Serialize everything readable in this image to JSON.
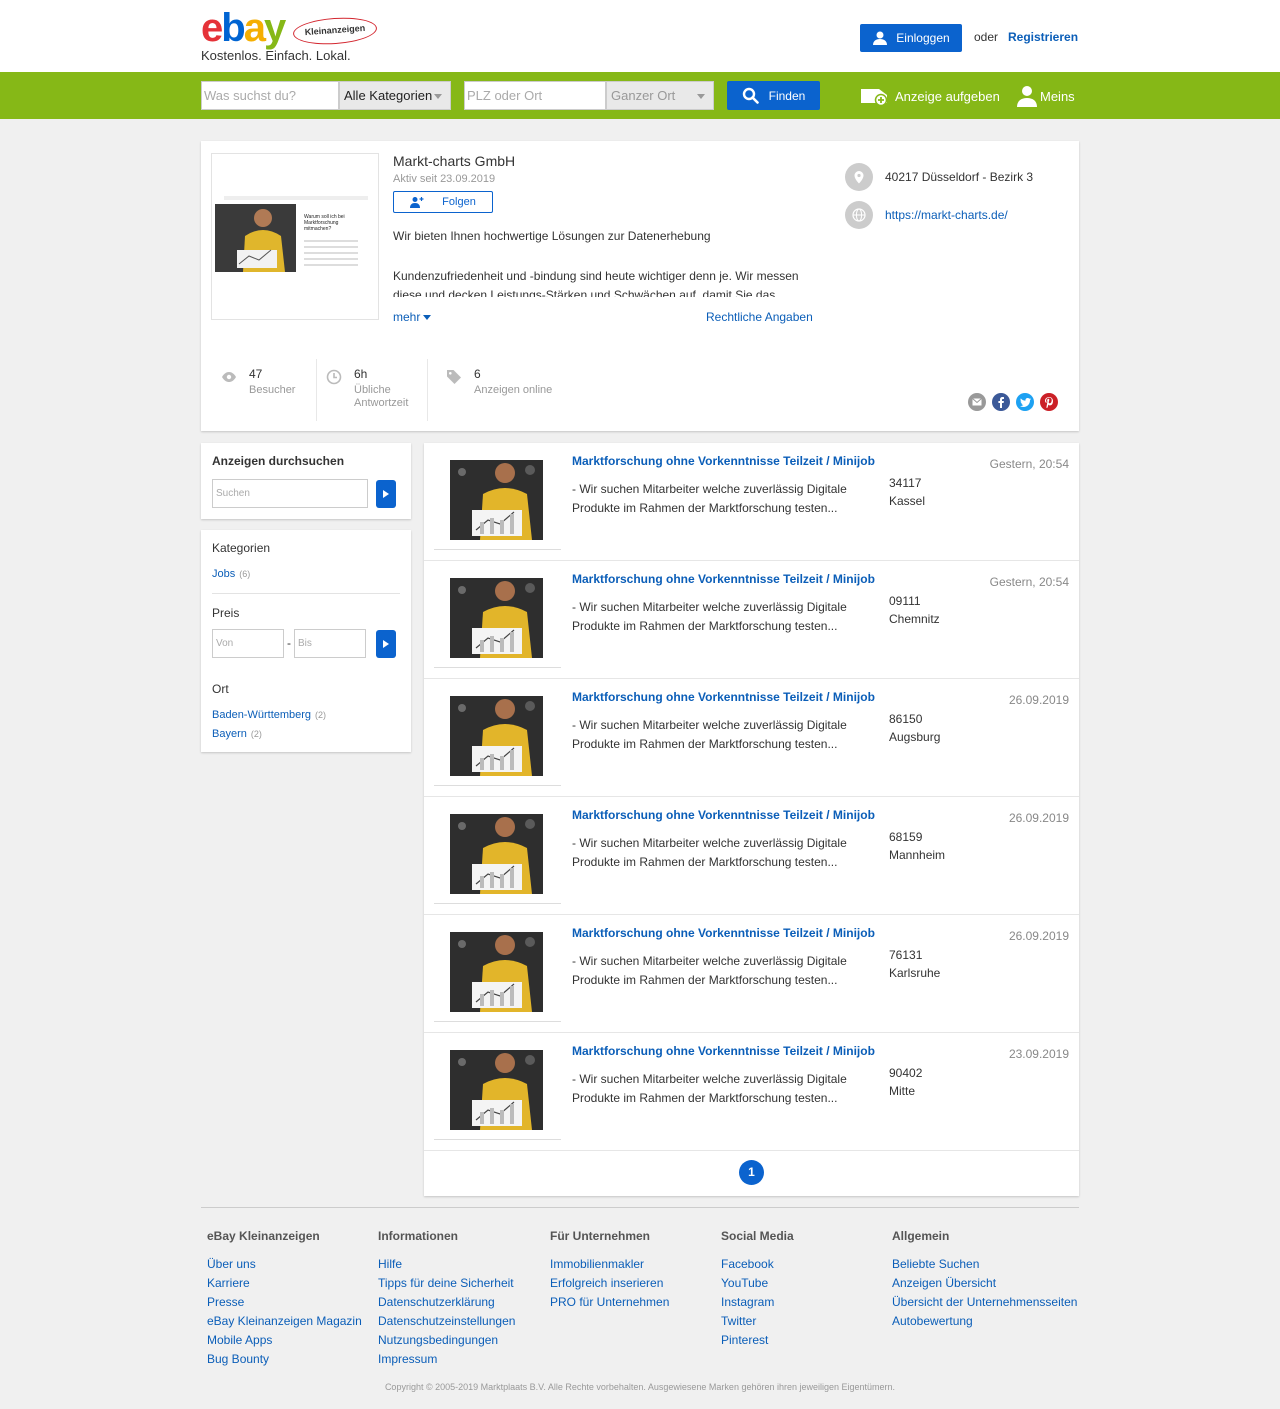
{
  "header": {
    "logo_badge": "Kleinanzeigen",
    "slogan": "Kostenlos. Einfach. Lokal.",
    "login_label": "Einloggen",
    "or_label": "oder",
    "register_label": "Registrieren"
  },
  "searchbar": {
    "query_placeholder": "Was suchst du?",
    "category_selected": "Alle Kategorien",
    "location_placeholder": "PLZ oder Ort",
    "radius_selected": "Ganzer Ort",
    "find_label": "Finden",
    "post_ad_label": "Anzeige aufgeben",
    "my_label": "Meins"
  },
  "profile": {
    "name": "Markt-charts GmbH",
    "active_since": "Aktiv seit 23.09.2019",
    "follow_label": "Folgen",
    "description_line1": "Wir bieten Ihnen hochwertige Lösungen zur Datenerhebung",
    "description_line2": "Kundenzufriedenheit und -bindung sind heute wichtiger denn je. Wir messen diese und decken Leistungs-Stärken und Schwächen auf, damit Sie das",
    "more_label": "mehr",
    "legal_label": "Rechtliche Angaben",
    "address": "40217 Düsseldorf - Bezirk 3",
    "website": "https://markt-charts.de/",
    "preview_text": "Warum soll ich bei Marktforschung mitmachen?",
    "stats": {
      "visitors_value": "47",
      "visitors_label": "Besucher",
      "response_value": "6h",
      "response_label_line1": "Übliche",
      "response_label_line2": "Antwortzeit",
      "ads_value": "6",
      "ads_label": "Anzeigen online"
    }
  },
  "sidebar": {
    "search_title": "Anzeigen durchsuchen",
    "search_placeholder": "Suchen",
    "categories_title": "Kategorien",
    "categories": [
      {
        "label": "Jobs",
        "count": "(6)"
      }
    ],
    "price_title": "Preis",
    "price_from_placeholder": "Von",
    "price_dash": "-",
    "price_to_placeholder": "Bis",
    "location_title": "Ort",
    "locations": [
      {
        "label": "Baden-Württemberg",
        "count": "(2)"
      },
      {
        "label": "Bayern",
        "count": "(2)"
      }
    ]
  },
  "listings": [
    {
      "title": "Marktforschung ohne Vorkenntnisse Teilzeit / Minijob",
      "desc": "- Wir suchen Mitarbeiter welche zuverlässig Digitale Produkte im Rahmen der Marktforschung testen...",
      "zip": "34117",
      "city": "Kassel",
      "date": "Gestern, 20:54"
    },
    {
      "title": "Marktforschung ohne Vorkenntnisse Teilzeit / Minijob",
      "desc": "- Wir suchen Mitarbeiter welche zuverlässig Digitale Produkte im Rahmen der Marktforschung testen...",
      "zip": "09111",
      "city": "Chemnitz",
      "date": "Gestern, 20:54"
    },
    {
      "title": "Marktforschung ohne Vorkenntnisse Teilzeit / Minijob",
      "desc": "- Wir suchen Mitarbeiter welche zuverlässig Digitale Produkte im Rahmen der Marktforschung testen...",
      "zip": "86150",
      "city": "Augsburg",
      "date": "26.09.2019"
    },
    {
      "title": "Marktforschung ohne Vorkenntnisse Teilzeit / Minijob",
      "desc": "- Wir suchen Mitarbeiter welche zuverlässig Digitale Produkte im Rahmen der Marktforschung testen...",
      "zip": "68159",
      "city": "Mannheim",
      "date": "26.09.2019"
    },
    {
      "title": "Marktforschung ohne Vorkenntnisse Teilzeit / Minijob",
      "desc": "- Wir suchen Mitarbeiter welche zuverlässig Digitale Produkte im Rahmen der Marktforschung testen...",
      "zip": "76131",
      "city": "Karlsruhe",
      "date": "26.09.2019"
    },
    {
      "title": "Marktforschung ohne Vorkenntnisse Teilzeit / Minijob",
      "desc": "- Wir suchen Mitarbeiter welche zuverlässig Digitale Produkte im Rahmen der Marktforschung testen...",
      "zip": "90402",
      "city": "Mitte",
      "date": "23.09.2019"
    }
  ],
  "pagination": {
    "current": "1"
  },
  "footer": {
    "columns": [
      {
        "title": "eBay Kleinanzeigen",
        "links": [
          "Über uns",
          "Karriere",
          "Presse",
          "eBay Kleinanzeigen Magazin",
          "Mobile Apps",
          "Bug Bounty"
        ]
      },
      {
        "title": "Informationen",
        "links": [
          "Hilfe",
          "Tipps für deine Sicherheit",
          "Datenschutzerklärung",
          "Datenschutzeinstellungen",
          "Nutzungsbedingungen",
          "Impressum"
        ]
      },
      {
        "title": "Für Unternehmen",
        "links": [
          "Immobilienmakler",
          "Erfolgreich inserieren",
          "PRO für Unternehmen"
        ]
      },
      {
        "title": "Social Media",
        "links": [
          "Facebook",
          "YouTube",
          "Instagram",
          "Twitter",
          "Pinterest"
        ]
      },
      {
        "title": "Allgemein",
        "links": [
          "Beliebte Suchen",
          "Anzeigen Übersicht",
          "Übersicht der Unternehmensseiten",
          "Autobewertung"
        ]
      }
    ],
    "copyright": "Copyright © 2005-2019 Marktplaats B.V. Alle Rechte vorbehalten. Ausgewiesene Marken gehören ihren jeweiligen Eigentümern."
  },
  "colors": {
    "brand_green": "#86b817",
    "primary_blue": "#0b63ce",
    "link_blue": "#0b5eb8",
    "social": {
      "mail": "#999999",
      "facebook": "#3b5998",
      "twitter": "#1da1f2",
      "pinterest": "#cb2027"
    }
  },
  "icons": {
    "social": [
      "mail-icon",
      "facebook-icon",
      "twitter-icon",
      "pinterest-icon"
    ]
  }
}
